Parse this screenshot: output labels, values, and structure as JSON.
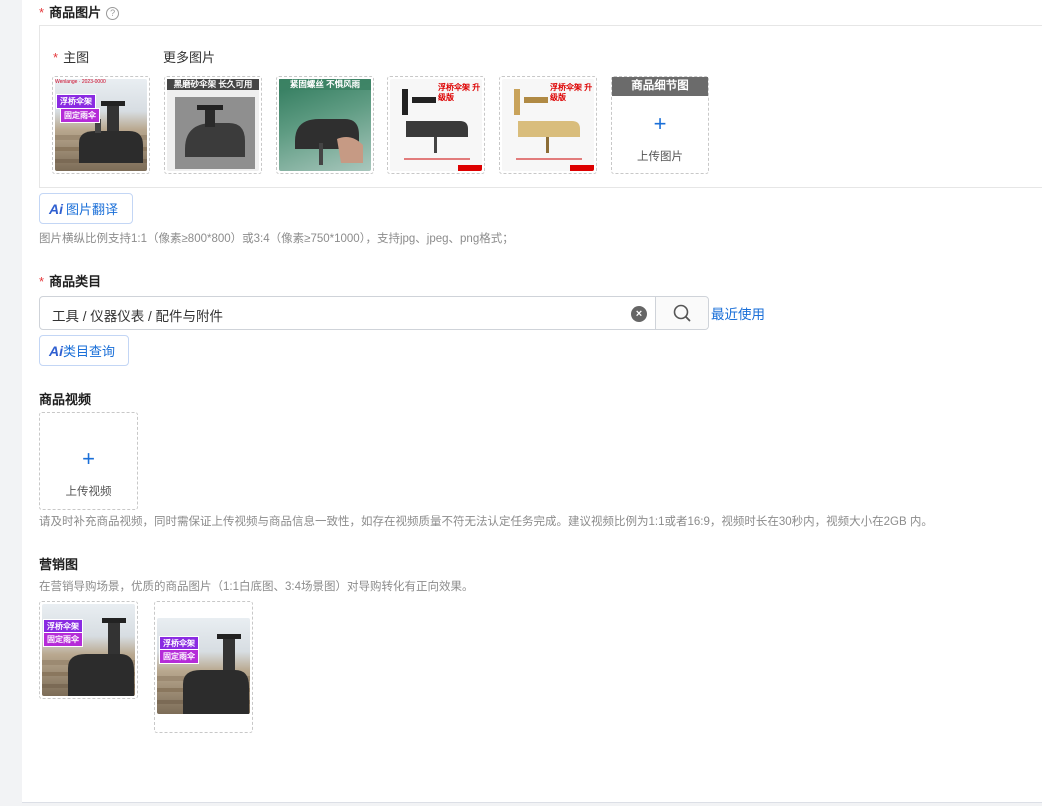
{
  "product_images": {
    "label": "商品图片",
    "help_icon": "question-circle-icon",
    "main_label": "主图",
    "more_label": "更多图片",
    "thumbs": [
      {
        "tag1": "浮桥伞架",
        "tag2": "固定雨伞",
        "header": "Wenlange · 2023-0000"
      },
      {
        "caption": "黑磨砂伞架 长久可用"
      },
      {
        "caption": "紧固螺丝 不惧风雨"
      },
      {
        "caption": "浮桥伞架 升级版"
      },
      {
        "caption": "浮桥伞架 升级版"
      }
    ],
    "detail_header": "商品细节图",
    "upload_label": "上传图片",
    "ai_translate_label": "图片翻译",
    "ai_icon": "Ai",
    "hint": "图片横纵比例支持1:1（像素≥800*800）或3:4（像素≥750*1000），支持jpg、jpeg、png格式；"
  },
  "category": {
    "label": "商品类目",
    "value": "工具 / 仪器仪表 / 配件与附件",
    "recent_label": "最近使用",
    "ai_query_label": "类目查询",
    "ai_icon": "Ai"
  },
  "video": {
    "label": "商品视频",
    "upload_label": "上传视频",
    "hint": "请及时补充商品视频，同时需保证上传视频与商品信息一致性，如存在视频质量不符无法认定任务完成。建议视频比例为1:1或者16:9，视频时长在30秒内，视频大小在2GB 内。"
  },
  "marketing": {
    "label": "营销图",
    "hint": "在营销导购场景，优质的商品图片（1:1白底图、3:4场景图）对导购转化有正向效果。",
    "images": [
      {
        "tag1": "浮桥伞架",
        "tag2": "固定雨伞"
      },
      {
        "tag1": "浮桥伞架",
        "tag2": "固定雨伞"
      }
    ]
  },
  "colors": {
    "accent": "#1a6fd8",
    "required": "#e5373a",
    "tag": "#b52bd8"
  }
}
